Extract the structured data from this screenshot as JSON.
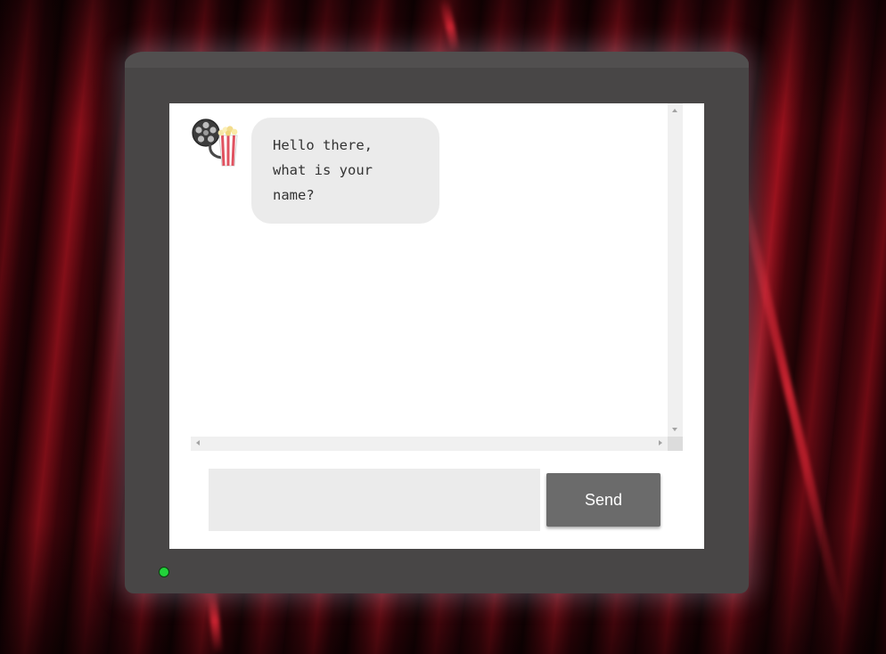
{
  "chat": {
    "messages": [
      {
        "sender": "bot",
        "avatar_icon": "film-reel-popcorn-icon",
        "text": "Hello there, what is your name?"
      }
    ]
  },
  "input": {
    "value": "",
    "placeholder": ""
  },
  "send_button": {
    "label": "Send"
  },
  "status": {
    "power_led_color": "#22d23a"
  },
  "colors": {
    "monitor_frame": "#484646",
    "bubble_bg": "#ebebeb",
    "send_button_bg": "#6b6b6b",
    "curtain_red": "#8c0d18"
  }
}
